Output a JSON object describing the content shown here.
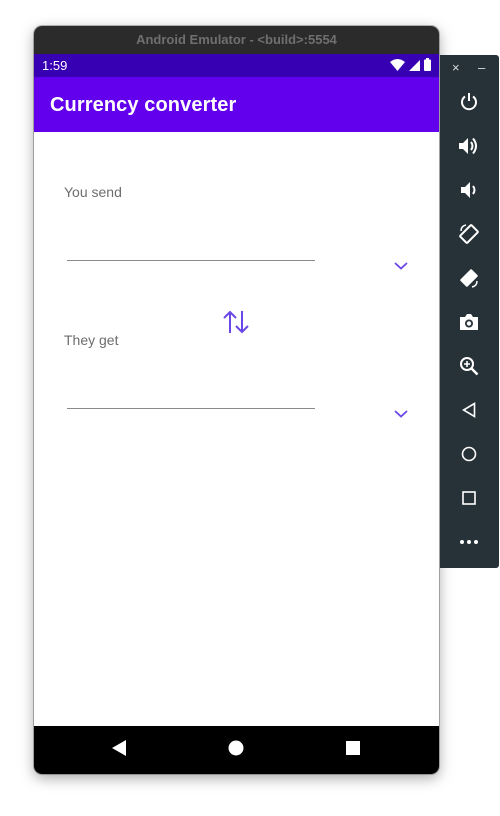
{
  "emulator": {
    "title": "Android Emulator - <build>:5554"
  },
  "status_bar": {
    "time": "1:59",
    "icons": [
      "wifi-icon",
      "cell-signal-icon",
      "battery-icon"
    ]
  },
  "app_bar": {
    "title": "Currency converter"
  },
  "form": {
    "send_label": "You send",
    "send_value": "",
    "get_label": "They get",
    "get_value": "",
    "dropdown_icon": "chevron-down-icon",
    "swap_icon": "swap-vertical-icon"
  },
  "nav_bar": {
    "buttons": [
      "back-icon",
      "home-icon",
      "recents-icon"
    ]
  },
  "side_toolbar": {
    "window_controls": [
      "close-icon",
      "minimize-icon"
    ],
    "close_glyph": "×",
    "minimize_glyph": "–",
    "tools": [
      "power-icon",
      "volume-up-icon",
      "volume-down-icon",
      "rotate-left-icon",
      "rotate-right-icon",
      "camera-icon",
      "zoom-icon",
      "back-icon",
      "home-icon",
      "overview-icon",
      "more-icon"
    ]
  },
  "colors": {
    "status_bar": "#3700b3",
    "app_bar": "#6200ee",
    "accent": "#6200ee",
    "toolbar": "#273238"
  }
}
